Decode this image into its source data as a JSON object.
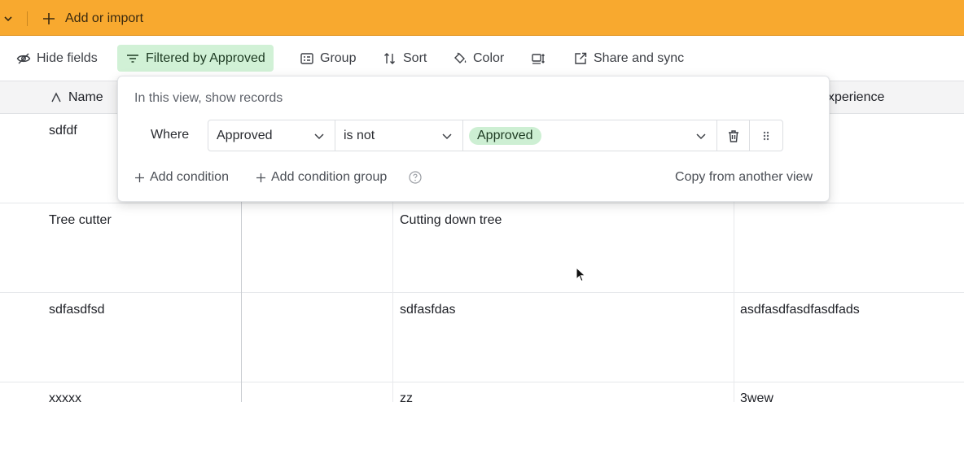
{
  "topbar": {
    "add_label": "Add or import"
  },
  "toolbar": {
    "hide_fields": "Hide fields",
    "filter": "Filtered by Approved",
    "group": "Group",
    "sort": "Sort",
    "color": "Color",
    "share": "Share and sync"
  },
  "columns": {
    "name": "Name",
    "experience": "xperience"
  },
  "rows": [
    {
      "name": "sdfdf",
      "col3": "",
      "col4": ""
    },
    {
      "name": "Tree cutter",
      "col3": "Cutting down tree",
      "col4": ""
    },
    {
      "name": "sdfasdfsd",
      "col3": "sdfasfdas",
      "col4": "asdfasdfasdfasdfads"
    },
    {
      "name": "xxxxx",
      "col3": "zz",
      "col4": "3wew"
    }
  ],
  "filter_popover": {
    "title": "In this view, show records",
    "where": "Where",
    "field": "Approved",
    "operator": "is not",
    "value": "Approved",
    "add_condition": "Add condition",
    "add_condition_group": "Add condition group",
    "copy_from": "Copy from another view"
  },
  "colors": {
    "topbar": "#f8a92f",
    "filter_active": "#d1f1d6",
    "pill": "#cdefd3"
  }
}
